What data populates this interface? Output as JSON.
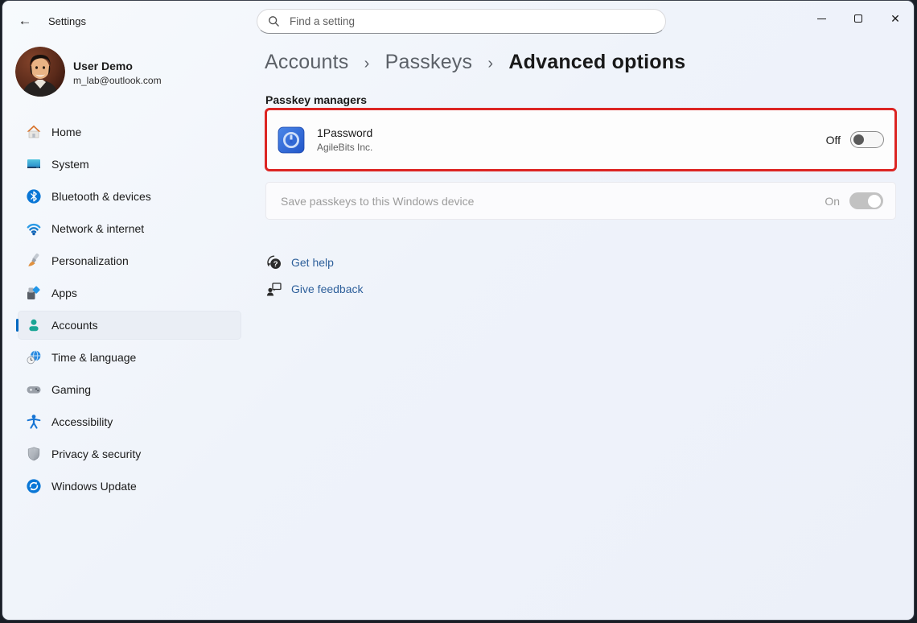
{
  "titlebar": {
    "app_title": "Settings",
    "search_placeholder": "Find a setting"
  },
  "user": {
    "name": "User Demo",
    "email": "m_lab@outlook.com"
  },
  "sidebar": {
    "items": [
      {
        "label": "Home"
      },
      {
        "label": "System"
      },
      {
        "label": "Bluetooth & devices"
      },
      {
        "label": "Network & internet"
      },
      {
        "label": "Personalization"
      },
      {
        "label": "Apps"
      },
      {
        "label": "Accounts",
        "selected": true
      },
      {
        "label": "Time & language"
      },
      {
        "label": "Gaming"
      },
      {
        "label": "Accessibility"
      },
      {
        "label": "Privacy & security"
      },
      {
        "label": "Windows Update"
      }
    ]
  },
  "breadcrumb": {
    "parts": [
      "Accounts",
      "Passkeys"
    ],
    "separator": "›",
    "current": "Advanced options"
  },
  "content": {
    "section_label": "Passkey managers",
    "manager": {
      "name": "1Password",
      "publisher": "AgileBits Inc.",
      "toggle_label": "Off",
      "toggle_state": "off",
      "highlighted": true
    },
    "device_row": {
      "label": "Save passkeys to this Windows device",
      "toggle_label": "On",
      "toggle_state": "on",
      "disabled": true
    },
    "links": [
      {
        "label": "Get help"
      },
      {
        "label": "Give feedback"
      }
    ]
  },
  "colors": {
    "accent": "#0067C0",
    "highlight_red": "#DC2523",
    "link_blue": "#2D5F9A",
    "background": "#EFF3FA"
  }
}
